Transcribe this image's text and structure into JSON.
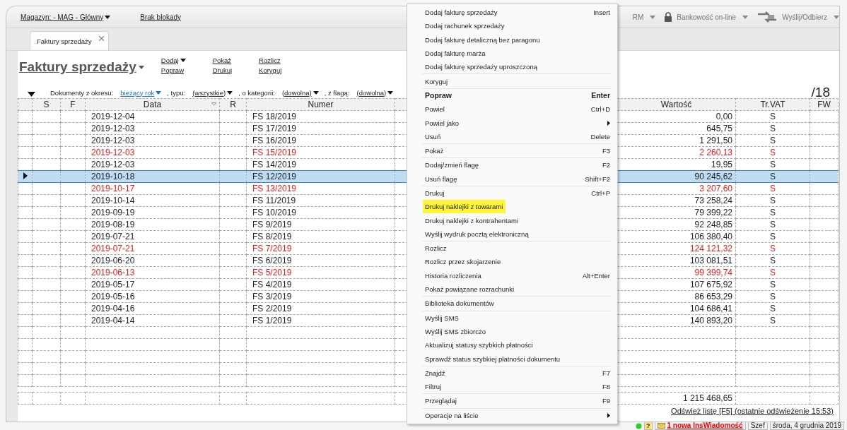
{
  "top_bar": {
    "warehouse": "Magazyn: - MAG - Główny",
    "lock": "Brak blokady",
    "toolbar": [
      {
        "label": "RM"
      },
      {
        "label": "Bankowość on-line"
      },
      {
        "label": "Wyślij/Odbierz"
      }
    ]
  },
  "tabs": [
    {
      "label": "Faktury sprzedaży",
      "selected": true
    }
  ],
  "title": "Faktury sprzedaży",
  "actions": [
    [
      "Dodaj",
      "Popraw"
    ],
    [
      "Pokaż",
      "Drukuj"
    ],
    [
      "Rozlicz",
      "Koryguj"
    ]
  ],
  "filters": [
    {
      "label": "Dokumenty z okresu:",
      "value": "bieżący rok",
      "kind": "link"
    },
    {
      "label": ", typu:",
      "value": "(wszystkie)",
      "kind": "plain"
    },
    {
      "label": ", o kategorii:",
      "value": "(dowolna)",
      "kind": "plain"
    },
    {
      "label": ", z flagą:",
      "value": "(dowolna)",
      "kind": "plain"
    }
  ],
  "count": "/18",
  "table": {
    "columns": [
      "S",
      "F",
      "Data",
      "R",
      "Numer",
      "Wartość",
      "Tr.VAT",
      "FW"
    ],
    "rows": [
      {
        "date": "2019-12-04",
        "number": "FS 18/2019",
        "value": "0,00",
        "vat": "S",
        "flagged": false,
        "selected": false
      },
      {
        "date": "2019-12-03",
        "number": "FS 17/2019",
        "value": "645,75",
        "vat": "S",
        "flagged": false,
        "selected": false
      },
      {
        "date": "2019-12-03",
        "number": "FS 16/2019",
        "value": "1 291,50",
        "vat": "S",
        "flagged": false,
        "selected": false
      },
      {
        "date": "2019-12-03",
        "number": "FS 15/2019",
        "value": "2 260,13",
        "vat": "S",
        "flagged": true,
        "selected": false
      },
      {
        "date": "2019-12-03",
        "number": "FS 14/2019",
        "value": "19,95",
        "vat": "S",
        "flagged": false,
        "selected": false
      },
      {
        "date": "2019-10-18",
        "number": "FS 12/2019",
        "value": "90 245,62",
        "vat": "S",
        "flagged": false,
        "selected": true
      },
      {
        "date": "2019-10-17",
        "number": "FS 13/2019",
        "value": "3 207,60",
        "vat": "S",
        "flagged": true,
        "selected": false
      },
      {
        "date": "2019-10-14",
        "number": "FS 11/2019",
        "value": "73 258,24",
        "vat": "S",
        "flagged": false,
        "selected": false
      },
      {
        "date": "2019-09-19",
        "number": "FS 10/2019",
        "value": "79 399,22",
        "vat": "S",
        "flagged": false,
        "selected": false
      },
      {
        "date": "2019-08-19",
        "number": "FS 9/2019",
        "value": "92 248,85",
        "vat": "S",
        "flagged": false,
        "selected": false
      },
      {
        "date": "2019-07-21",
        "number": "FS 8/2019",
        "value": "106 380,40",
        "vat": "S",
        "flagged": false,
        "selected": false
      },
      {
        "date": "2019-07-21",
        "number": "FS 7/2019",
        "value": "124 121,32",
        "vat": "S",
        "flagged": true,
        "selected": false
      },
      {
        "date": "2019-06-20",
        "number": "FS 6/2019",
        "value": "103 081,51",
        "vat": "S",
        "flagged": false,
        "selected": false
      },
      {
        "date": "2019-06-13",
        "number": "FS 5/2019",
        "value": "99 399,74",
        "vat": "S",
        "flagged": true,
        "selected": false
      },
      {
        "date": "2019-05-17",
        "number": "FS 4/2019",
        "value": "107 675,92",
        "vat": "S",
        "flagged": false,
        "selected": false
      },
      {
        "date": "2019-05-16",
        "number": "FS 3/2019",
        "value": "86 653,29",
        "vat": "S",
        "flagged": false,
        "selected": false
      },
      {
        "date": "2019-04-16",
        "number": "FS 2/2019",
        "value": "104 686,41",
        "vat": "S",
        "flagged": false,
        "selected": false
      },
      {
        "date": "2019-04-14",
        "number": "FS 1/2019",
        "value": "140 893,20",
        "vat": "S",
        "flagged": false,
        "selected": false
      }
    ],
    "total": "1 215 468,65"
  },
  "refresh": "Odśwież listę [F5] (ostatnie odświeżenie 15:53)",
  "status_bar": {
    "help": "?",
    "messages": "1 nowa InsWiadomość",
    "user": "Szef",
    "date": "środa, 4 grudnia 2019"
  },
  "context_menu": [
    [
      {
        "label": "Dodaj fakturę sprzedaży",
        "shortcut": "Insert",
        "kind": "normal",
        "highlighted": false
      },
      {
        "label": "Dodaj rachunek sprzedaży",
        "kind": "normal",
        "highlighted": false
      },
      {
        "label": "Dodaj fakturę detaliczną bez paragonu",
        "kind": "normal",
        "highlighted": false
      },
      {
        "label": "Dodaj fakturę marża",
        "kind": "normal",
        "highlighted": false
      },
      {
        "label": "Dodaj fakturę sprzedaży uproszczoną",
        "kind": "normal",
        "highlighted": false
      }
    ],
    [
      {
        "label": "Koryguj",
        "kind": "normal",
        "highlighted": false
      }
    ],
    [
      {
        "label": "Popraw",
        "shortcut": "Enter",
        "kind": "default",
        "highlighted": false
      },
      {
        "label": "Powiel",
        "shortcut": "Ctrl+D",
        "kind": "normal",
        "highlighted": false
      },
      {
        "label": "Powiel jako",
        "kind": "submenu",
        "highlighted": false
      },
      {
        "label": "Usuń",
        "shortcut": "Delete",
        "kind": "normal",
        "highlighted": false
      }
    ],
    [
      {
        "label": "Pokaż",
        "shortcut": "F3",
        "kind": "normal",
        "highlighted": false
      }
    ],
    [
      {
        "label": "Dodaj/zmień flagę",
        "shortcut": "F2",
        "kind": "normal",
        "highlighted": false
      },
      {
        "label": "Usuń flagę",
        "shortcut": "Shift+F2",
        "kind": "normal",
        "highlighted": false
      }
    ],
    [
      {
        "label": "Drukuj",
        "shortcut": "Ctrl+P",
        "kind": "normal",
        "highlighted": false
      },
      {
        "label": "Drukuj naklejki z towarami",
        "kind": "normal",
        "highlighted": true
      },
      {
        "label": "Drukuj naklejki z kontrahentami",
        "kind": "normal",
        "highlighted": false
      },
      {
        "label": "Wyślij wydruk pocztą elektroniczną",
        "kind": "normal",
        "highlighted": false
      }
    ],
    [
      {
        "label": "Rozlicz",
        "kind": "normal",
        "highlighted": false
      },
      {
        "label": "Rozlicz przez skojarzenie",
        "kind": "normal",
        "highlighted": false
      },
      {
        "label": "Historia rozliczenia",
        "shortcut": "Alt+Enter",
        "kind": "normal",
        "highlighted": false
      },
      {
        "label": "Pokaż powiązane rozrachunki",
        "kind": "normal",
        "highlighted": false
      }
    ],
    [
      {
        "label": "Biblioteka dokumentów",
        "kind": "normal",
        "highlighted": false
      }
    ],
    [
      {
        "label": "Wyślij SMS",
        "kind": "normal",
        "highlighted": false
      },
      {
        "label": "Wyślij SMS zbiorczo",
        "kind": "normal",
        "highlighted": false
      },
      {
        "label": "Aktualizuj statusy szybkich płatności",
        "kind": "normal",
        "highlighted": false
      },
      {
        "label": "Sprawdź status szybkiej płatności dokumentu",
        "kind": "normal",
        "highlighted": false
      }
    ],
    [
      {
        "label": "Znajdź",
        "shortcut": "F7",
        "kind": "normal",
        "highlighted": false
      },
      {
        "label": "Filtruj",
        "shortcut": "F8",
        "kind": "normal",
        "highlighted": false
      }
    ],
    [
      {
        "label": "Przeglądaj",
        "shortcut": "F9",
        "kind": "normal",
        "highlighted": false
      }
    ],
    [
      {
        "label": "Operacje na liście",
        "kind": "submenu",
        "highlighted": false
      }
    ]
  ]
}
